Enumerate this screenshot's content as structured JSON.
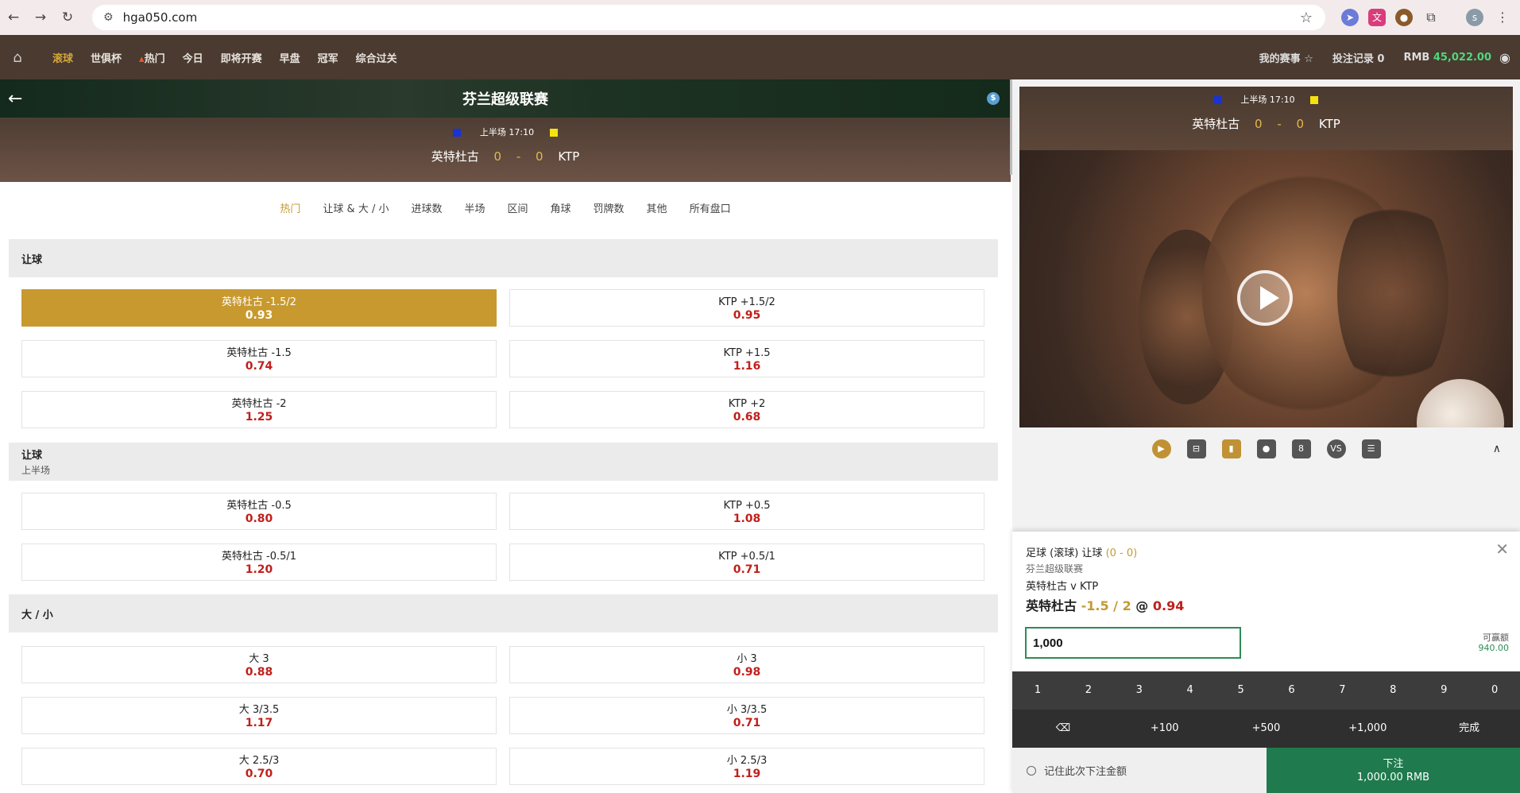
{
  "browser": {
    "url": "hga050.com",
    "profile_initial": "s"
  },
  "topnav": {
    "items": [
      "滚球",
      "世俱杯",
      "热门",
      "今日",
      "即将开赛",
      "早盘",
      "冠军",
      "综合过关"
    ],
    "active": "滚球",
    "my_matches": "我的赛事",
    "bet_records": "投注记录",
    "bet_records_count": "0",
    "currency": "RMB",
    "balance": "45,022.00"
  },
  "match": {
    "league": "芬兰超级联赛",
    "period": "上半场",
    "time": "17:10",
    "home": "英特杜古",
    "away": "KTP",
    "home_score": "0",
    "away_score": "0",
    "score_sep": "-",
    "colors": {
      "home_shirt": "#1a33d4",
      "away_shirt": "#f4e30e"
    }
  },
  "tabs": [
    "热门",
    "让球 & 大 / 小",
    "进球数",
    "半场",
    "区间",
    "角球",
    "罚牌数",
    "其他",
    "所有盘口"
  ],
  "sections": {
    "handicap": {
      "title": "让球",
      "rows": [
        [
          {
            "label": "英特杜古 -1.5/2",
            "price": "0.93"
          },
          {
            "label": "KTP +1.5/2",
            "price": "0.95"
          }
        ],
        [
          {
            "label": "英特杜古 -1.5",
            "price": "0.74"
          },
          {
            "label": "KTP +1.5",
            "price": "1.16"
          }
        ],
        [
          {
            "label": "英特杜古 -2",
            "price": "1.25"
          },
          {
            "label": "KTP +2",
            "price": "0.68"
          }
        ]
      ]
    },
    "handicap_half": {
      "title": "让球",
      "subtitle": "上半场",
      "rows": [
        [
          {
            "label": "英特杜古 -0.5",
            "price": "0.80"
          },
          {
            "label": "KTP +0.5",
            "price": "1.08"
          }
        ],
        [
          {
            "label": "英特杜古 -0.5/1",
            "price": "1.20"
          },
          {
            "label": "KTP +0.5/1",
            "price": "0.71"
          }
        ]
      ]
    },
    "over_under": {
      "title": "大 / 小",
      "rows": [
        [
          {
            "label": "大 3",
            "price": "0.88"
          },
          {
            "label": "小 3",
            "price": "0.98"
          }
        ],
        [
          {
            "label": "大 3/3.5",
            "price": "1.17"
          },
          {
            "label": "小 3/3.5",
            "price": "0.71"
          }
        ],
        [
          {
            "label": "大 2.5/3",
            "price": "0.70"
          },
          {
            "label": "小 2.5/3",
            "price": "1.19"
          }
        ]
      ]
    }
  },
  "video_tools": [
    "play-circle-icon",
    "pitch-icon",
    "stats-icon",
    "mic-icon",
    "shirt-icon",
    "vs-icon",
    "scoreboard-icon"
  ],
  "video_tool_labels": {
    "shirt": "8",
    "vs": "VS"
  },
  "slip": {
    "title": "足球 (滚球) 让球",
    "score": "(0 - 0)",
    "league": "芬兰超级联赛",
    "match": "英特杜古 v KTP",
    "pick_team": "英特杜古",
    "pick_hc": "-1.5 / 2",
    "at": "@",
    "pick_odds": "0.94",
    "stake": "1,000",
    "available_label": "可赢额",
    "available_amount": "940.00",
    "keys": [
      "1",
      "2",
      "3",
      "4",
      "5",
      "6",
      "7",
      "8",
      "9",
      "0"
    ],
    "quick": [
      "⌫",
      "+100",
      "+500",
      "+1,000",
      "完成"
    ],
    "remember": "记住此次下注金额",
    "place_label": "下注",
    "place_amount": "1,000.00 RMB"
  }
}
